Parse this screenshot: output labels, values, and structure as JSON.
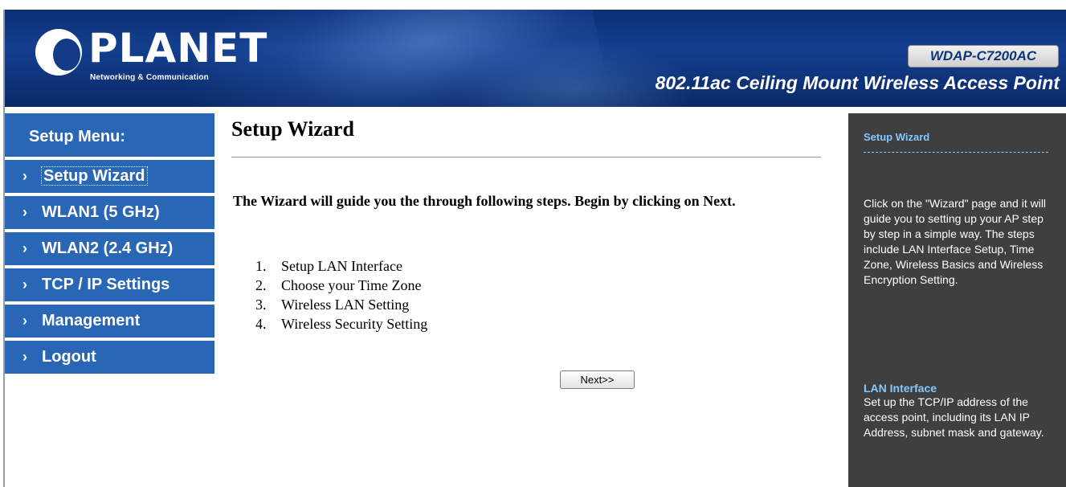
{
  "header": {
    "logo_text": "PLANET",
    "logo_subtitle": "Networking & Communication",
    "model": "WDAP-C7200AC",
    "product_title": "802.11ac Ceiling Mount Wireless Access Point"
  },
  "sidebar": {
    "title": "Setup Menu:",
    "items": [
      {
        "label": "Setup Wizard"
      },
      {
        "label": "WLAN1 (5 GHz)"
      },
      {
        "label": "WLAN2 (2.4 GHz)"
      },
      {
        "label": "TCP / IP Settings"
      },
      {
        "label": "Management"
      },
      {
        "label": "Logout"
      }
    ]
  },
  "main": {
    "title": "Setup Wizard",
    "intro": "The Wizard will guide you the through following steps. Begin by clicking on Next.",
    "steps": [
      {
        "num": "1.",
        "text": "Setup LAN Interface"
      },
      {
        "num": "2.",
        "text": "Choose your Time Zone"
      },
      {
        "num": "3.",
        "text": "Wireless LAN Setting"
      },
      {
        "num": "4.",
        "text": "Wireless Security Setting"
      }
    ],
    "next_label": "Next>>"
  },
  "help": {
    "title": "Setup Wizard",
    "body": "Click on the \"Wizard\" page and it will guide you to setting up your AP step by step in a simple way. The steps include LAN Interface Setup, Time Zone, Wireless Basics and Wireless Encryption Setting.",
    "section_title": "LAN Interface",
    "section_body": "Set up the TCP/IP address of the access point, including its LAN IP Address, subnet mask and gateway."
  },
  "colors": {
    "header_bg": "#133f8f",
    "menu_bg": "#2a66b6",
    "help_bg": "#3f3f3f",
    "help_accent": "#86c7ff"
  }
}
